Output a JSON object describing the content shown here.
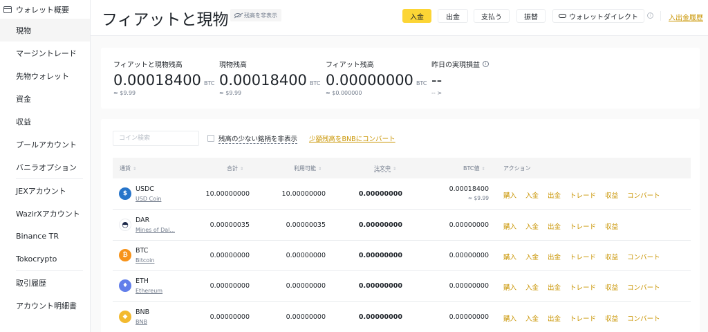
{
  "sidebar": {
    "header": "ウォレット概要",
    "items": [
      {
        "label": "現物",
        "active": true
      },
      {
        "label": "マージントレード"
      },
      {
        "label": "先物ウォレット"
      },
      {
        "label": "資金"
      },
      {
        "label": "収益"
      },
      {
        "label": "プールアカウント"
      },
      {
        "label": "バニラオプション"
      },
      {
        "label": "JEXアカウント"
      },
      {
        "label": "WazirXアカウント"
      },
      {
        "label": "Binance TR"
      },
      {
        "label": "Tokocrypto"
      },
      {
        "label": "取引履歴"
      },
      {
        "label": "アカウント明細書"
      }
    ]
  },
  "header": {
    "title": "フィアットと現物",
    "hide_balance": "残高を非表示",
    "buttons": {
      "deposit": "入金",
      "withdraw": "出金",
      "pay": "支払う",
      "transfer": "振替",
      "wallet_direct": "ウォレットダイレクト"
    },
    "history_link": "入出金履歴"
  },
  "balances": [
    {
      "label": "フィアットと現物残高",
      "value": "0.00018400",
      "unit": "BTC",
      "sub": "≈ $9.99"
    },
    {
      "label": "現物残高",
      "value": "0.00018400",
      "unit": "BTC",
      "sub": "≈ $9.99"
    },
    {
      "label": "フィアット残高",
      "value": "0.00000000",
      "unit": "BTC",
      "sub": "≈ $0.000000"
    },
    {
      "label": "昨日の実現損益",
      "value": "--",
      "sub": "--  >"
    }
  ],
  "filters": {
    "search_placeholder": "コイン検索",
    "hide_small": "残高の少ない銘柄を非表示",
    "convert_link": "少額残高をBNBにコンバート"
  },
  "table": {
    "headers": {
      "coin": "通貨",
      "total": "合計",
      "available": "利用可能",
      "in_order": "注文中",
      "btc_value": "BTC値",
      "action": "アクション"
    },
    "rows": [
      {
        "symbol": "USDC",
        "name": "USD Coin",
        "color": "#2775ca",
        "glyph": "$",
        "total": "10.00000000",
        "available": "10.00000000",
        "in_order": "0.00000000",
        "btc": "0.00018400",
        "usd": "≈ $9.99",
        "actions": [
          "購入",
          "入金",
          "出金",
          "トレード",
          "収益",
          "コンバート"
        ]
      },
      {
        "symbol": "DAR",
        "name": "Mines of Dal...",
        "color": "#ffffff",
        "glyph": "◓",
        "total": "0.00000035",
        "available": "0.00000035",
        "in_order": "0.00000000",
        "btc": "0.00000000",
        "actions": [
          "購入",
          "入金",
          "出金",
          "トレード",
          "収益"
        ]
      },
      {
        "symbol": "BTC",
        "name": "Bitcoin",
        "color": "#f7931a",
        "glyph": "₿",
        "total": "0.00000000",
        "available": "0.00000000",
        "in_order": "0.00000000",
        "btc": "0.00000000",
        "actions": [
          "購入",
          "入金",
          "出金",
          "トレード",
          "収益",
          "コンバート"
        ]
      },
      {
        "symbol": "ETH",
        "name": "Ethereum",
        "color": "#627eea",
        "glyph": "♦",
        "total": "0.00000000",
        "available": "0.00000000",
        "in_order": "0.00000000",
        "btc": "0.00000000",
        "actions": [
          "購入",
          "入金",
          "出金",
          "トレード",
          "収益",
          "コンバート"
        ]
      },
      {
        "symbol": "BNB",
        "name": "BNB",
        "color": "#f3ba2f",
        "glyph": "◆",
        "total": "0.00000000",
        "available": "0.00000000",
        "in_order": "0.00000000",
        "btc": "0.00000000",
        "actions": [
          "購入",
          "入金",
          "出金",
          "トレード",
          "収益",
          "コンバート"
        ]
      }
    ]
  }
}
